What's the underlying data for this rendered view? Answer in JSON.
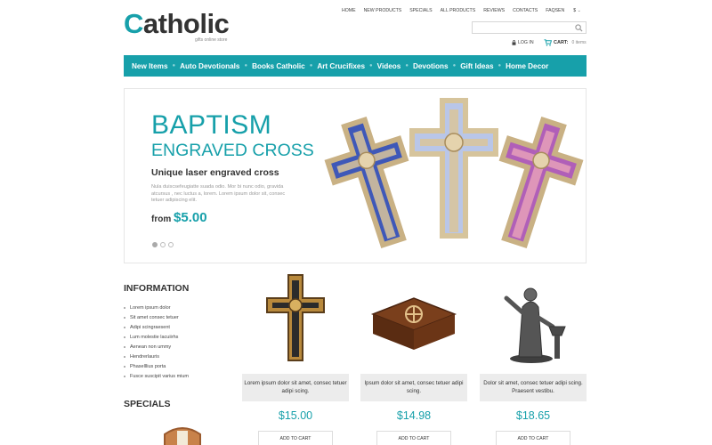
{
  "logo": {
    "first_letter": "C",
    "rest": "atholic",
    "tagline": "gifts online store"
  },
  "topnav": [
    "HOME",
    "NEW PRODUCTS",
    "SPECIALS",
    "ALL PRODUCTS",
    "REVIEWS",
    "CONTACTS",
    "FAQS"
  ],
  "lang": {
    "language": "EN",
    "currency": "$"
  },
  "search": {
    "placeholder": ""
  },
  "account": {
    "login": "LOG IN",
    "cart_label": "CART:",
    "cart_items": "0 items"
  },
  "mainnav": [
    "New Items",
    "Auto Devotionals",
    "Books Catholic",
    "Art Crucifixes",
    "Videos",
    "Devotions",
    "Gift Ideas",
    "Home Decor"
  ],
  "banner": {
    "title1": "BAPTISM",
    "title2": "ENGRAVED CROSS",
    "subtitle": "Unique laser engraved cross",
    "body": "Nula duiscsefeugiatte suada odio. Mor bi nunc odio, gravida atcursus , nec luctus a, lorem. Lorem ipsum dolor sit, consec tetuer adipiscing elit.",
    "from_label": "from",
    "price": "$5.00",
    "slides": 3,
    "active_slide": 1
  },
  "information": {
    "title": "INFORMATION",
    "items": [
      "Lorem ipsum dolor",
      "Sit amet consec tetuer",
      "Adipi scingraesent",
      "Lum molestie lacuiirhs",
      "Aenean non ummy",
      "Hendrerlauris",
      "Phaselllius porta",
      "Fusce suscipit varius mium"
    ]
  },
  "specials": {
    "title": "SPECIALS"
  },
  "products": [
    {
      "desc": "Lorem ipsum dolor sit amet, consec tetuer adipi scing.",
      "price": "$15.00",
      "button": "ADD TO CART"
    },
    {
      "desc": "Ipsum dolor sit amet, consec tetuer adipi scing.",
      "price": "$14.98",
      "button": "ADD TO CART"
    },
    {
      "desc": "Dolor sit amet, consec tetuer adipi scing. Praesent vestibu.",
      "price": "$18.65",
      "button": "ADD TO CART"
    }
  ],
  "colors": {
    "accent": "#17a0aa"
  }
}
